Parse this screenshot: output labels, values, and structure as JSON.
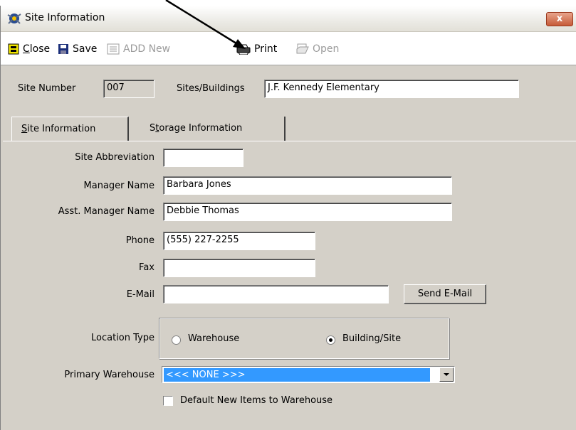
{
  "window": {
    "title": "Site Information",
    "close_glyph": "x"
  },
  "toolbar": {
    "close_label": "Close",
    "save_label": "Save",
    "add_new_label": "ADD New",
    "print_label": "Print",
    "open_label": "Open"
  },
  "header": {
    "site_number_label": "Site Number",
    "site_number_value": "007",
    "sites_buildings_label": "Sites/Buildings",
    "sites_buildings_value": "J.F. Kennedy Elementary"
  },
  "tabs": [
    {
      "label": "Site Information",
      "accel": "S",
      "rest": "ite Information",
      "active": true
    },
    {
      "label": "Storage Information",
      "accel": "t",
      "pre": "S",
      "rest": "orage Information",
      "active": false
    }
  ],
  "form": {
    "site_abbreviation": {
      "label": "Site Abbreviation",
      "value": ""
    },
    "manager_name": {
      "label": "Manager Name",
      "value": "Barbara Jones"
    },
    "asst_manager_name": {
      "label": "Asst. Manager Name",
      "value": "Debbie Thomas"
    },
    "phone": {
      "label": "Phone",
      "value": "(555) 227-2255"
    },
    "fax": {
      "label": "Fax",
      "value": ""
    },
    "email": {
      "label": "E-Mail",
      "value": ""
    },
    "send_email_label": "Send E-Mail",
    "location_type": {
      "label": "Location Type",
      "options": [
        "Warehouse",
        "Building/Site"
      ],
      "selected": "Building/Site"
    },
    "primary_warehouse": {
      "label": "Primary Warehouse",
      "value": "<<< NONE >>>"
    },
    "default_new_items": {
      "label": "Default New Items to Warehouse",
      "checked": false
    }
  },
  "colors": {
    "selection": "#3399ff",
    "dialog_bg": "#d4d0c8",
    "close_button": "#c65b39"
  },
  "icons": [
    "site-information-icon",
    "close-icon",
    "save-icon",
    "add-new-icon",
    "print-icon",
    "open-icon",
    "annotation-arrow"
  ]
}
